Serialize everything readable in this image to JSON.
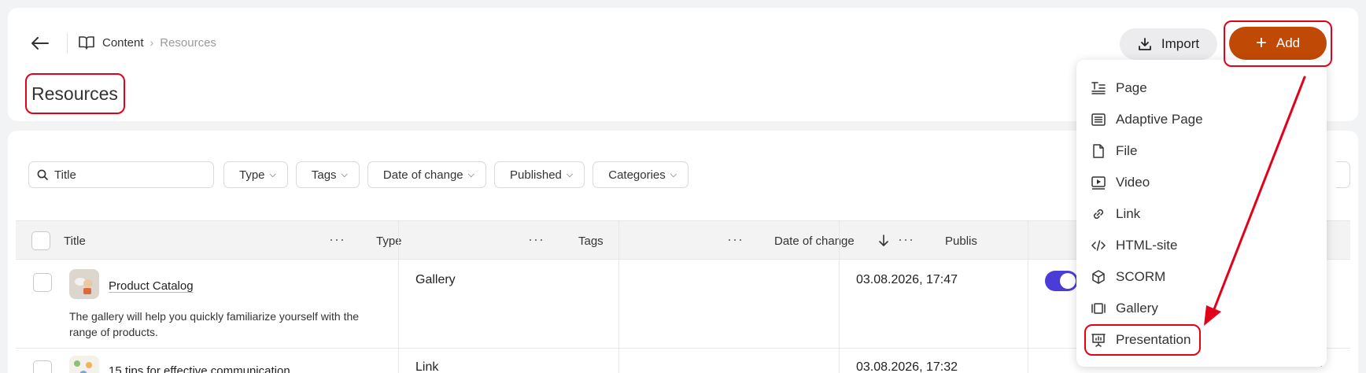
{
  "breadcrumb": {
    "root": "Content",
    "current": "Resources"
  },
  "page_title": "Resources",
  "actions": {
    "import_label": "Import",
    "add_label": "Add"
  },
  "filters": {
    "search_placeholder": "Title",
    "items": [
      "Type",
      "Tags",
      "Date of change",
      "Published",
      "Categories"
    ]
  },
  "table": {
    "columns": {
      "title": "Title",
      "type": "Type",
      "tags": "Tags",
      "date": "Date of change",
      "published": "Publis"
    },
    "rows": [
      {
        "title": "Product Catalog",
        "description": "The gallery will help you quickly familiarize yourself with the range of products.",
        "type": "Gallery",
        "date": "03.08.2026, 17:47",
        "published": true
      },
      {
        "title": "15 tips for effective communication",
        "type": "Link",
        "date": "03.08.2026, 17:32"
      }
    ]
  },
  "add_menu": {
    "items": [
      "Page",
      "Adaptive Page",
      "File",
      "Video",
      "Link",
      "HTML-site",
      "SCORM",
      "Gallery",
      "Presentation"
    ]
  },
  "colors": {
    "accent": "#c04a05",
    "highlight": "#e3001b",
    "toggle": "#4a3cd6"
  }
}
